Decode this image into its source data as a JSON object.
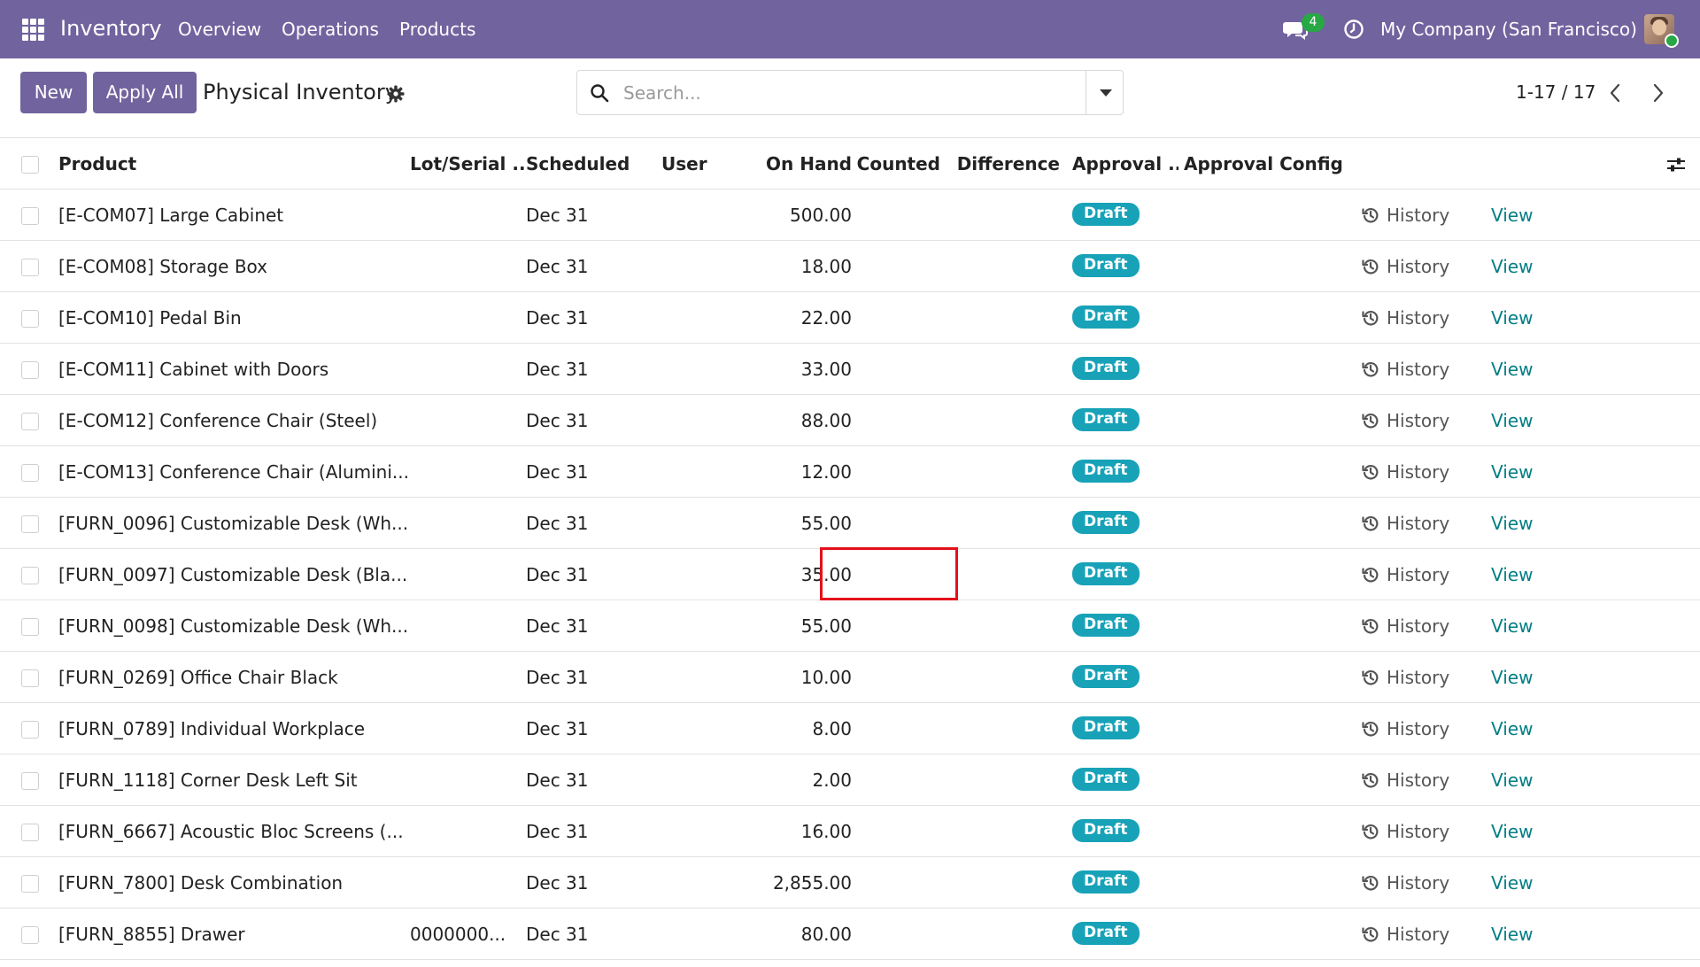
{
  "navbar": {
    "app_name": "Inventory",
    "menus": [
      "Overview",
      "Operations",
      "Products"
    ],
    "chat_count": "4",
    "company": "My Company (San Francisco)"
  },
  "control_panel": {
    "new_label": "New",
    "apply_all_label": "Apply All",
    "title": "Physical Inventory",
    "search_placeholder": "Search...",
    "pager": "1-17 / 17"
  },
  "table": {
    "columns": [
      "Product",
      "Lot/Serial ...",
      "Scheduled",
      "User",
      "On Hand",
      "Counted",
      "Difference",
      "Approval ...",
      "Approval Config"
    ],
    "history_label": "History",
    "view_label": "View",
    "rows": [
      {
        "product": "[E-COM07] Large Cabinet",
        "lot": "",
        "scheduled": "Dec 31",
        "user": "",
        "on_hand": "500.00",
        "counted": "",
        "difference": "",
        "status": "Draft"
      },
      {
        "product": "[E-COM08] Storage Box",
        "lot": "",
        "scheduled": "Dec 31",
        "user": "",
        "on_hand": "18.00",
        "counted": "",
        "difference": "",
        "status": "Draft"
      },
      {
        "product": "[E-COM10] Pedal Bin",
        "lot": "",
        "scheduled": "Dec 31",
        "user": "",
        "on_hand": "22.00",
        "counted": "",
        "difference": "",
        "status": "Draft"
      },
      {
        "product": "[E-COM11] Cabinet with Doors",
        "lot": "",
        "scheduled": "Dec 31",
        "user": "",
        "on_hand": "33.00",
        "counted": "",
        "difference": "",
        "status": "Draft"
      },
      {
        "product": "[E-COM12] Conference Chair (Steel)",
        "lot": "",
        "scheduled": "Dec 31",
        "user": "",
        "on_hand": "88.00",
        "counted": "",
        "difference": "",
        "status": "Draft"
      },
      {
        "product": "[E-COM13] Conference Chair (Alumini...",
        "lot": "",
        "scheduled": "Dec 31",
        "user": "",
        "on_hand": "12.00",
        "counted": "",
        "difference": "",
        "status": "Draft"
      },
      {
        "product": "[FURN_0096] Customizable Desk (Wh...",
        "lot": "",
        "scheduled": "Dec 31",
        "user": "",
        "on_hand": "55.00",
        "counted": "",
        "difference": "",
        "status": "Draft"
      },
      {
        "product": "[FURN_0097] Customizable Desk (Bla...",
        "lot": "",
        "scheduled": "Dec 31",
        "user": "",
        "on_hand": "35.00",
        "counted": "",
        "difference": "",
        "status": "Draft"
      },
      {
        "product": "[FURN_0098] Customizable Desk (Wh...",
        "lot": "",
        "scheduled": "Dec 31",
        "user": "",
        "on_hand": "55.00",
        "counted": "",
        "difference": "",
        "status": "Draft"
      },
      {
        "product": "[FURN_0269] Office Chair Black",
        "lot": "",
        "scheduled": "Dec 31",
        "user": "",
        "on_hand": "10.00",
        "counted": "",
        "difference": "",
        "status": "Draft"
      },
      {
        "product": "[FURN_0789] Individual Workplace",
        "lot": "",
        "scheduled": "Dec 31",
        "user": "",
        "on_hand": "8.00",
        "counted": "",
        "difference": "",
        "status": "Draft"
      },
      {
        "product": "[FURN_1118] Corner Desk Left Sit",
        "lot": "",
        "scheduled": "Dec 31",
        "user": "",
        "on_hand": "2.00",
        "counted": "",
        "difference": "",
        "status": "Draft"
      },
      {
        "product": "[FURN_6667] Acoustic Bloc Screens (...",
        "lot": "",
        "scheduled": "Dec 31",
        "user": "",
        "on_hand": "16.00",
        "counted": "",
        "difference": "",
        "status": "Draft"
      },
      {
        "product": "[FURN_7800] Desk Combination",
        "lot": "",
        "scheduled": "Dec 31",
        "user": "",
        "on_hand": "2,855.00",
        "counted": "",
        "difference": "",
        "status": "Draft"
      },
      {
        "product": "[FURN_8855] Drawer",
        "lot": "0000000...",
        "scheduled": "Dec 31",
        "user": "",
        "on_hand": "80.00",
        "counted": "",
        "difference": "",
        "status": "Draft"
      }
    ]
  },
  "colors": {
    "navbar": "#71639e",
    "primary_button": "#71639e",
    "badge": "#17a2b8",
    "link": "#017e84",
    "highlight": "#e3111c",
    "chat_badge": "#28a745"
  },
  "icons": [
    "apps-grid-icon",
    "chat-icon",
    "clock-icon",
    "gear-icon",
    "search-icon",
    "caret-down-icon",
    "chevron-left-icon",
    "chevron-right-icon",
    "history-icon",
    "optional-columns-icon"
  ]
}
